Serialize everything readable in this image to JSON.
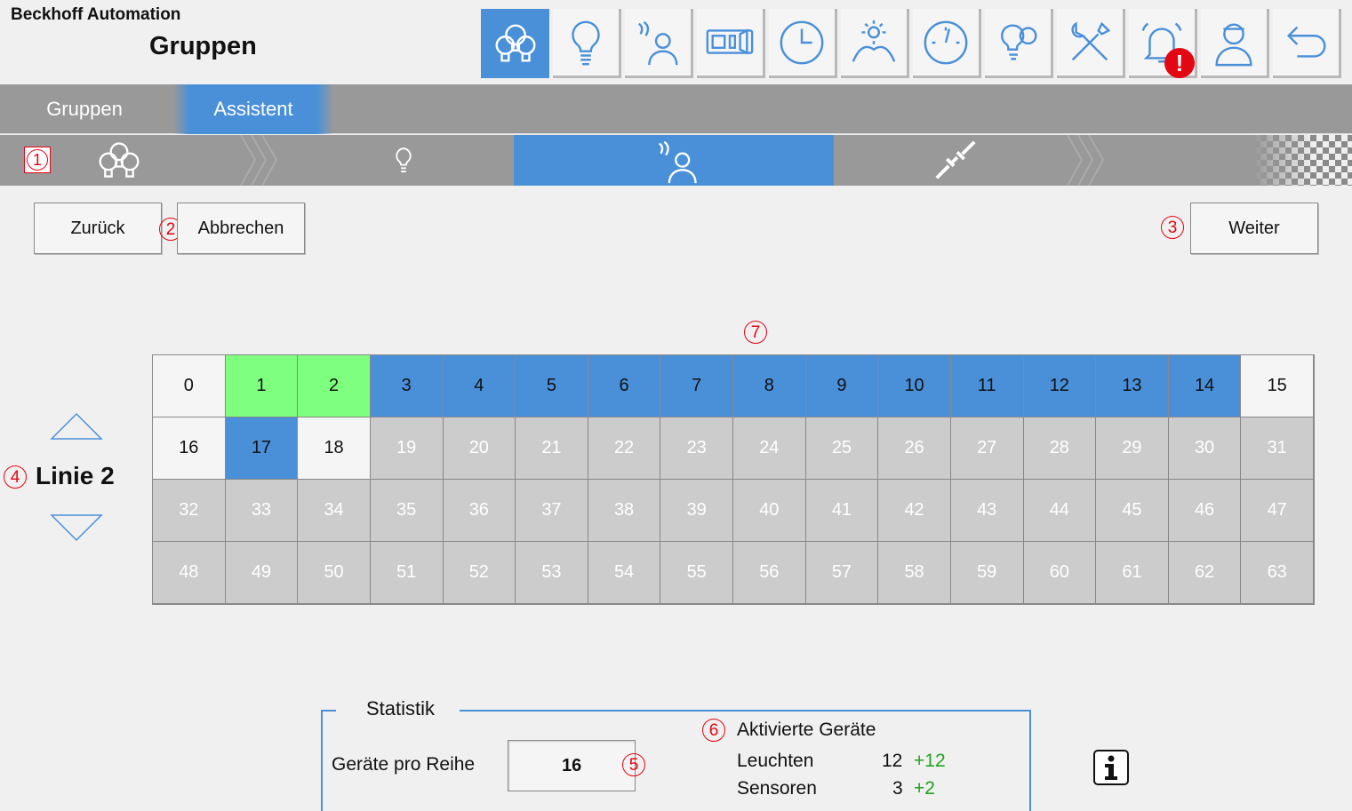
{
  "header": {
    "brand": "Beckhoff Automation",
    "title": "Gruppen"
  },
  "toolbar": [
    {
      "icon": "lamp-group-icon",
      "active": true
    },
    {
      "icon": "bulb-icon",
      "active": false
    },
    {
      "icon": "presence-sensor-icon",
      "active": false
    },
    {
      "icon": "switch-panel-icon",
      "active": false
    },
    {
      "icon": "clock-icon",
      "active": false
    },
    {
      "icon": "daylight-icon",
      "active": false
    },
    {
      "icon": "gauge-icon",
      "active": false
    },
    {
      "icon": "bulb-settings-icon",
      "active": false
    },
    {
      "icon": "tools-icon",
      "active": false
    },
    {
      "icon": "alarm-bell-icon",
      "active": false,
      "badge": "!"
    },
    {
      "icon": "user-icon",
      "active": false
    },
    {
      "icon": "undo-icon",
      "active": false
    }
  ],
  "tabs": [
    {
      "label": "Gruppen",
      "active": false
    },
    {
      "label": "Assistent",
      "active": true
    }
  ],
  "steps": [
    {
      "icon": "lamp-group-icon",
      "active": false
    },
    {
      "icon": "bulb-icon",
      "active": false
    },
    {
      "icon": "presence-sensor-icon",
      "active": true
    },
    {
      "icon": "broken-link-icon",
      "active": false
    },
    {
      "icon": "finish-flag-icon",
      "active": false
    }
  ],
  "markers": {
    "m1": "1",
    "m2": "2",
    "m3": "3",
    "m4": "4",
    "m5": "5",
    "m6": "6",
    "m7": "7"
  },
  "buttons": {
    "back": "Zurück",
    "cancel": "Abbrechen",
    "next": "Weiter"
  },
  "line": {
    "label": "Linie 2"
  },
  "grid": {
    "cells": [
      {
        "n": "0",
        "s": "free"
      },
      {
        "n": "1",
        "s": "new"
      },
      {
        "n": "2",
        "s": "new"
      },
      {
        "n": "3",
        "s": "used"
      },
      {
        "n": "4",
        "s": "used"
      },
      {
        "n": "5",
        "s": "used"
      },
      {
        "n": "6",
        "s": "used"
      },
      {
        "n": "7",
        "s": "used"
      },
      {
        "n": "8",
        "s": "used"
      },
      {
        "n": "9",
        "s": "used"
      },
      {
        "n": "10",
        "s": "used"
      },
      {
        "n": "11",
        "s": "used"
      },
      {
        "n": "12",
        "s": "used"
      },
      {
        "n": "13",
        "s": "used"
      },
      {
        "n": "14",
        "s": "used"
      },
      {
        "n": "15",
        "s": "free"
      },
      {
        "n": "16",
        "s": "free"
      },
      {
        "n": "17",
        "s": "used"
      },
      {
        "n": "18",
        "s": "free"
      },
      {
        "n": "19",
        "s": "off"
      },
      {
        "n": "20",
        "s": "off"
      },
      {
        "n": "21",
        "s": "off"
      },
      {
        "n": "22",
        "s": "off"
      },
      {
        "n": "23",
        "s": "off"
      },
      {
        "n": "24",
        "s": "off"
      },
      {
        "n": "25",
        "s": "off"
      },
      {
        "n": "26",
        "s": "off"
      },
      {
        "n": "27",
        "s": "off"
      },
      {
        "n": "28",
        "s": "off"
      },
      {
        "n": "29",
        "s": "off"
      },
      {
        "n": "30",
        "s": "off"
      },
      {
        "n": "31",
        "s": "off"
      },
      {
        "n": "32",
        "s": "off"
      },
      {
        "n": "33",
        "s": "off"
      },
      {
        "n": "34",
        "s": "off"
      },
      {
        "n": "35",
        "s": "off"
      },
      {
        "n": "36",
        "s": "off"
      },
      {
        "n": "37",
        "s": "off"
      },
      {
        "n": "38",
        "s": "off"
      },
      {
        "n": "39",
        "s": "off"
      },
      {
        "n": "40",
        "s": "off"
      },
      {
        "n": "41",
        "s": "off"
      },
      {
        "n": "42",
        "s": "off"
      },
      {
        "n": "43",
        "s": "off"
      },
      {
        "n": "44",
        "s": "off"
      },
      {
        "n": "45",
        "s": "off"
      },
      {
        "n": "46",
        "s": "off"
      },
      {
        "n": "47",
        "s": "off"
      },
      {
        "n": "48",
        "s": "off"
      },
      {
        "n": "49",
        "s": "off"
      },
      {
        "n": "50",
        "s": "off"
      },
      {
        "n": "51",
        "s": "off"
      },
      {
        "n": "52",
        "s": "off"
      },
      {
        "n": "53",
        "s": "off"
      },
      {
        "n": "54",
        "s": "off"
      },
      {
        "n": "55",
        "s": "off"
      },
      {
        "n": "56",
        "s": "off"
      },
      {
        "n": "57",
        "s": "off"
      },
      {
        "n": "58",
        "s": "off"
      },
      {
        "n": "59",
        "s": "off"
      },
      {
        "n": "60",
        "s": "off"
      },
      {
        "n": "61",
        "s": "off"
      },
      {
        "n": "62",
        "s": "off"
      },
      {
        "n": "63",
        "s": "off"
      }
    ]
  },
  "stats": {
    "legend": "Statistik",
    "devices_per_row_label": "Geräte pro Reihe",
    "devices_per_row_value": "16",
    "activated_title": "Aktivierte Geräte",
    "lights_label": "Leuchten",
    "lights_value": "12",
    "lights_delta": "+12",
    "sensors_label": "Sensoren",
    "sensors_value": "3",
    "sensors_delta": "+2"
  },
  "colors": {
    "accent": "#4a90d9",
    "new": "#7fff7f",
    "disabled": "#cccccc",
    "alert": "#e30613",
    "delta": "#22a31d"
  }
}
